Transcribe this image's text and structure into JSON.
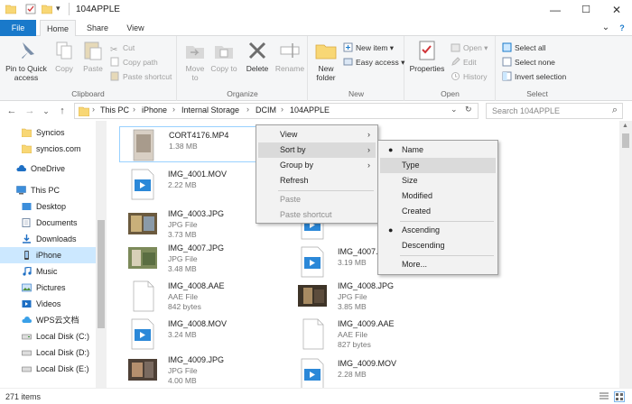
{
  "window": {
    "title": "104APPLE",
    "minimize_glyph": "—",
    "maximize_glyph": "☐",
    "close_glyph": "✕"
  },
  "quick_access": {
    "icons": [
      "folder-icon",
      "properties-check-icon",
      "new-folder-icon",
      "dropdown-arrow-icon"
    ],
    "dropdown_glyph": "▾"
  },
  "tabs": [
    {
      "label": "File"
    },
    {
      "label": "Home"
    },
    {
      "label": "Share"
    },
    {
      "label": "View"
    }
  ],
  "ribbon": {
    "expand_glyph": "⌄",
    "help_glyph": "?",
    "clipboard": {
      "label": "Clipboard",
      "pin": "Pin to Quick access",
      "copy": "Copy",
      "paste": "Paste",
      "cut": "Cut",
      "copy_path": "Copy path",
      "paste_shortcut": "Paste shortcut"
    },
    "organize": {
      "label": "Organize",
      "move_to": "Move to",
      "copy_to": "Copy to",
      "delete": "Delete",
      "rename": "Rename"
    },
    "new": {
      "label": "New",
      "new_folder": "New folder",
      "new_item": "New item",
      "easy_access": "Easy access"
    },
    "open": {
      "label": "Open",
      "properties": "Properties",
      "open": "Open",
      "edit": "Edit",
      "history": "History"
    },
    "select": {
      "label": "Select",
      "select_all": "Select all",
      "select_none": "Select none",
      "invert": "Invert selection"
    }
  },
  "address": {
    "back_glyph": "←",
    "forward_glyph": "→",
    "recent_glyph": "⌄",
    "up_glyph": "↑",
    "refresh_glyph": "↻",
    "dropdown_glyph": "⌄",
    "separator": "›",
    "crumbs": [
      "This PC",
      "iPhone",
      "Internal Storage",
      "DCIM",
      "104APPLE"
    ],
    "search_placeholder": "Search 104APPLE",
    "search_glyph": "⌕"
  },
  "nav": [
    {
      "label": "Syncios",
      "icon": "folder-icon"
    },
    {
      "label": "syncios.com",
      "icon": "folder-icon"
    },
    {
      "label": "OneDrive",
      "icon": "cloud-icon"
    },
    {
      "label": "This PC",
      "icon": "computer-icon"
    },
    {
      "label": "Desktop",
      "icon": "desktop-icon"
    },
    {
      "label": "Documents",
      "icon": "documents-icon"
    },
    {
      "label": "Downloads",
      "icon": "downloads-icon"
    },
    {
      "label": "iPhone",
      "icon": "phone-icon"
    },
    {
      "label": "Music",
      "icon": "music-icon"
    },
    {
      "label": "Pictures",
      "icon": "pictures-icon"
    },
    {
      "label": "Videos",
      "icon": "videos-icon"
    },
    {
      "label": "WPS云文档",
      "icon": "cloud-doc-icon"
    },
    {
      "label": "Local Disk (C:)",
      "icon": "disk-icon"
    },
    {
      "label": "Local Disk (D:)",
      "icon": "disk-icon"
    },
    {
      "label": "Local Disk (E:)",
      "icon": "disk-icon"
    }
  ],
  "files": [
    {
      "name": "CORT4176.MP4",
      "type": "",
      "size": "1.38 MB",
      "kind": "photo"
    },
    {
      "name": "IMG_4001.MOV",
      "type": "",
      "size": "2.22 MB",
      "kind": "video"
    },
    {
      "name": "IMG_4003.JPG",
      "type": "JPG File",
      "size": "3.73 MB",
      "kind": "photo"
    },
    {
      "name": "IMG_4007.JPG",
      "type": "JPG File",
      "size": "3.48 MB",
      "kind": "photo"
    },
    {
      "name": "IMG_4008.AAE",
      "type": "AAE File",
      "size": "842 bytes",
      "kind": "doc"
    },
    {
      "name": "IMG_4008.MOV",
      "type": "",
      "size": "3.24 MB",
      "kind": "video"
    },
    {
      "name": "IMG_4009.JPG",
      "type": "JPG File",
      "size": "4.00 MB",
      "kind": "photo"
    },
    {
      "name": "",
      "type": "",
      "size": "3.29 MB",
      "kind": "video"
    },
    {
      "name": "IMG_4007.MOV",
      "type": "",
      "size": "3.19 MB",
      "kind": "video"
    },
    {
      "name": "IMG_4008.JPG",
      "type": "JPG File",
      "size": "3.85 MB",
      "kind": "photo"
    },
    {
      "name": "IMG_4009.AAE",
      "type": "AAE File",
      "size": "827 bytes",
      "kind": "doc"
    },
    {
      "name": "IMG_4009.MOV",
      "type": "",
      "size": "2.28 MB",
      "kind": "video"
    }
  ],
  "status": {
    "items": "271 items"
  },
  "context_menu": {
    "items": [
      {
        "label": "View",
        "arrow": "›",
        "disabled": false
      },
      {
        "label": "Sort by",
        "arrow": "›",
        "disabled": false
      },
      {
        "label": "Group by",
        "arrow": "›",
        "disabled": false
      },
      {
        "label": "Refresh",
        "arrow": "",
        "disabled": false
      },
      {
        "label": "Paste",
        "arrow": "",
        "disabled": true
      },
      {
        "label": "Paste shortcut",
        "arrow": "",
        "disabled": true
      }
    ]
  },
  "sort_menu": {
    "bullet": "●",
    "items": [
      {
        "label": "Name",
        "checked": true
      },
      {
        "label": "Type",
        "checked": false
      },
      {
        "label": "Size",
        "checked": false
      },
      {
        "label": "Modified",
        "checked": false
      },
      {
        "label": "Created",
        "checked": false
      },
      {
        "label": "Ascending",
        "checked": true
      },
      {
        "label": "Descending",
        "checked": false
      },
      {
        "label": "More...",
        "checked": false
      }
    ]
  },
  "colors": {
    "file_tab": "#1979ca",
    "selection": "#cce8ff",
    "video_blue": "#2b88d8",
    "folder_yellow": "#f8d775",
    "delete_red": "#d13438"
  }
}
